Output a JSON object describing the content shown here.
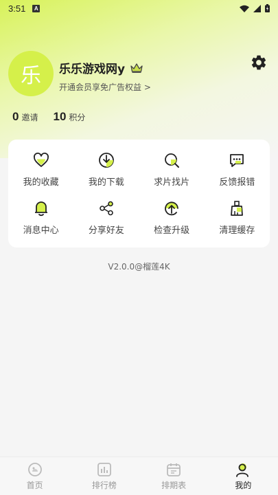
{
  "status_bar": {
    "time": "3:51",
    "badge": "A"
  },
  "profile": {
    "avatar_char": "乐",
    "username": "乐乐游戏网y",
    "vip_link": "开通会员享免广告权益 >"
  },
  "stats": [
    {
      "value": "0",
      "label": "邀请"
    },
    {
      "value": "10",
      "label": "积分"
    }
  ],
  "menu": [
    {
      "label": "我的收藏",
      "icon": "heart-icon"
    },
    {
      "label": "我的下载",
      "icon": "download-icon"
    },
    {
      "label": "求片找片",
      "icon": "search-film-icon"
    },
    {
      "label": "反馈报错",
      "icon": "feedback-icon"
    },
    {
      "label": "消息中心",
      "icon": "bell-icon"
    },
    {
      "label": "分享好友",
      "icon": "share-icon"
    },
    {
      "label": "检查升级",
      "icon": "upgrade-icon"
    },
    {
      "label": "清理缓存",
      "icon": "broom-icon"
    }
  ],
  "version": "V2.0.0@榴莲4K",
  "tabs": [
    {
      "label": "首页",
      "icon": "home-icon",
      "active": false
    },
    {
      "label": "排行榜",
      "icon": "ranking-icon",
      "active": false
    },
    {
      "label": "排期表",
      "icon": "calendar-icon",
      "active": false
    },
    {
      "label": "我的",
      "icon": "profile-icon",
      "active": true
    }
  ],
  "colors": {
    "accent": "#d5f04a",
    "text": "#222222",
    "muted": "#999999"
  }
}
